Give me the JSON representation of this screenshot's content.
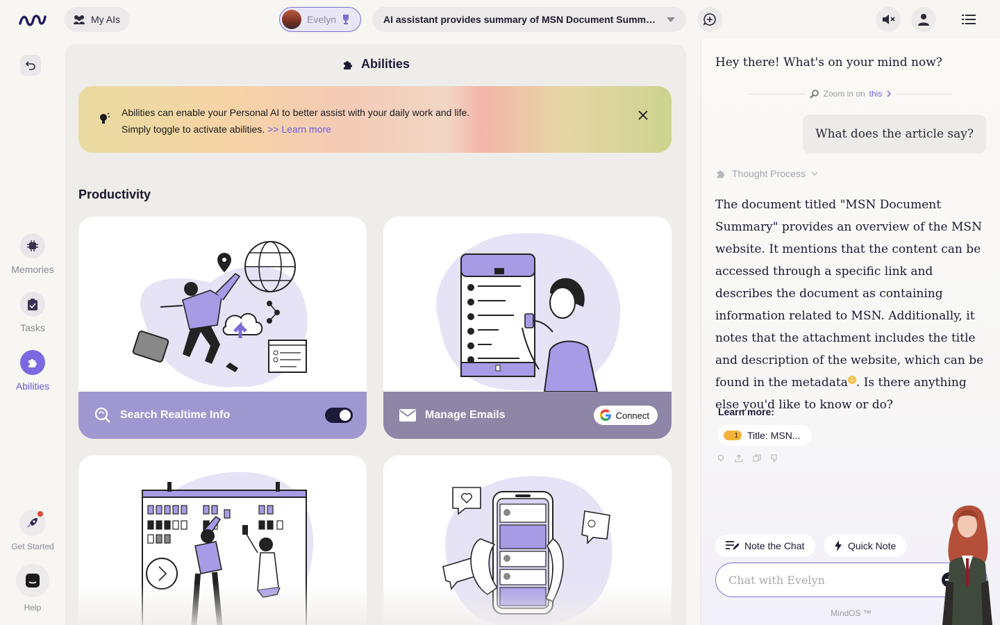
{
  "topbar": {
    "my_ais_label": "My AIs",
    "persona_name": "Evelyn",
    "conversation_title": "AI assistant provides summary of MSN Document Summary"
  },
  "rail": {
    "items": [
      {
        "label": "Memories",
        "icon": "chip-icon"
      },
      {
        "label": "Tasks",
        "icon": "clipboard-icon"
      },
      {
        "label": "Abilities",
        "icon": "puzzle-icon"
      }
    ],
    "get_started_label": "Get Started",
    "help_label": "Help"
  },
  "main": {
    "title": "Abilities",
    "banner": {
      "line1": "Abilities can enable your Personal AI to better assist with your daily work and life.",
      "line2": "Simply toggle to activate abilities.",
      "link": ">> Learn more"
    },
    "section_title": "Productivity",
    "cards": [
      {
        "title": "Search Realtime Info",
        "action": "toggle",
        "enabled": true,
        "color": "#9f97cf"
      },
      {
        "title": "Manage Emails",
        "action": "connect",
        "action_label": "Connect",
        "color": "#8d86a6"
      }
    ]
  },
  "chat": {
    "greeting": "Hey there! What's on your mind now?",
    "zoom_prefix": "Zoom in on",
    "zoom_link": "this",
    "user_message": "What does the article say?",
    "thought_label": "Thought Process",
    "answer_part1": "The document titled \"MSN Document Summary\" provides an overview of the MSN website. It mentions that the content can be accessed through a specific link and describes the document as containing information related to MSN. Additionally, it notes that the attachment includes the title and description of the website, which can be found in the metadata",
    "citation": "1",
    "answer_part2": ". Is there anything else you'd like to know or do?",
    "learn_more_label": "Learn more:",
    "source_chip": {
      "badge": "1",
      "label": "Title: MSN..."
    },
    "note_chat_label": "Note the Chat",
    "quick_note_label": "Quick Note",
    "input_placeholder": "Chat with Evelyn",
    "footer": "MindOS ™"
  },
  "colors": {
    "accent": "#7b68e2",
    "card_search": "#9f97cf",
    "card_email": "#8d86a6"
  }
}
